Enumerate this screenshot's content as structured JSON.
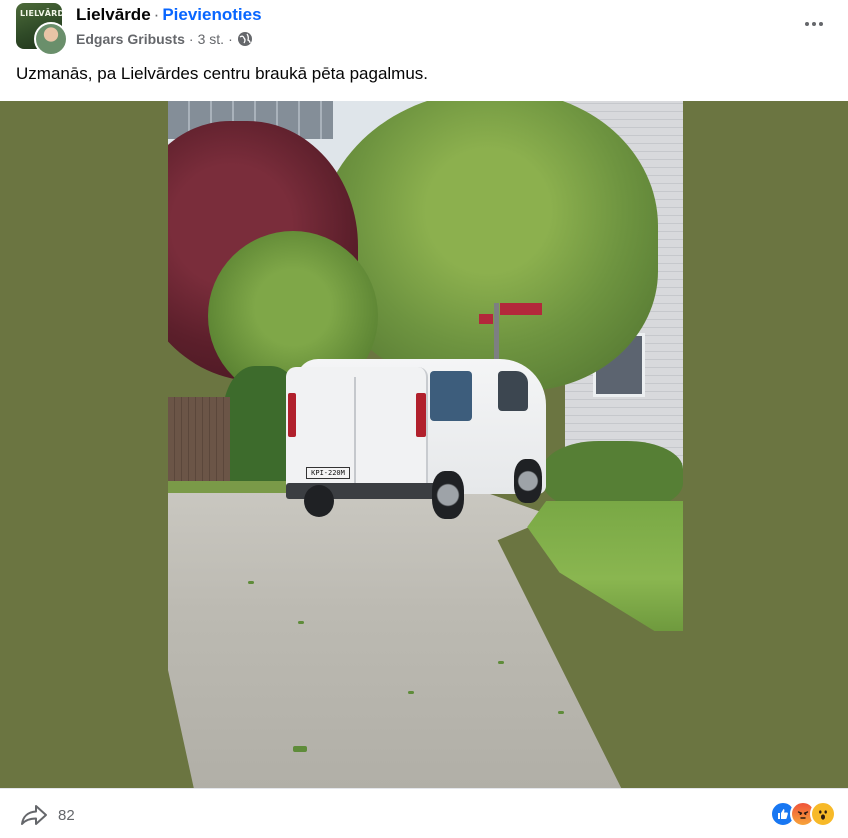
{
  "header": {
    "group_name": "Lielvārde",
    "separator": "·",
    "join_label": "Pievienoties",
    "author": "Edgars Gribusts",
    "time": "3 st.",
    "privacy_icon": "globe-icon",
    "group_avatar_text": "LIELVĀRDE",
    "more_icon": "more-horizontal-icon"
  },
  "post": {
    "text": "Uzmanās, pa Lielvārdes centru braukā pēta pagalmus."
  },
  "photo": {
    "plate_text": "KPI-220M",
    "background_color": "#6b7541"
  },
  "footer": {
    "share_icon": "share-icon",
    "share_count": "82",
    "reactions": [
      "like",
      "angry",
      "wow"
    ]
  },
  "colors": {
    "link": "#0866ff",
    "secondary_text": "#65676b",
    "like": "#1877f2",
    "wow": "#f7b928"
  }
}
